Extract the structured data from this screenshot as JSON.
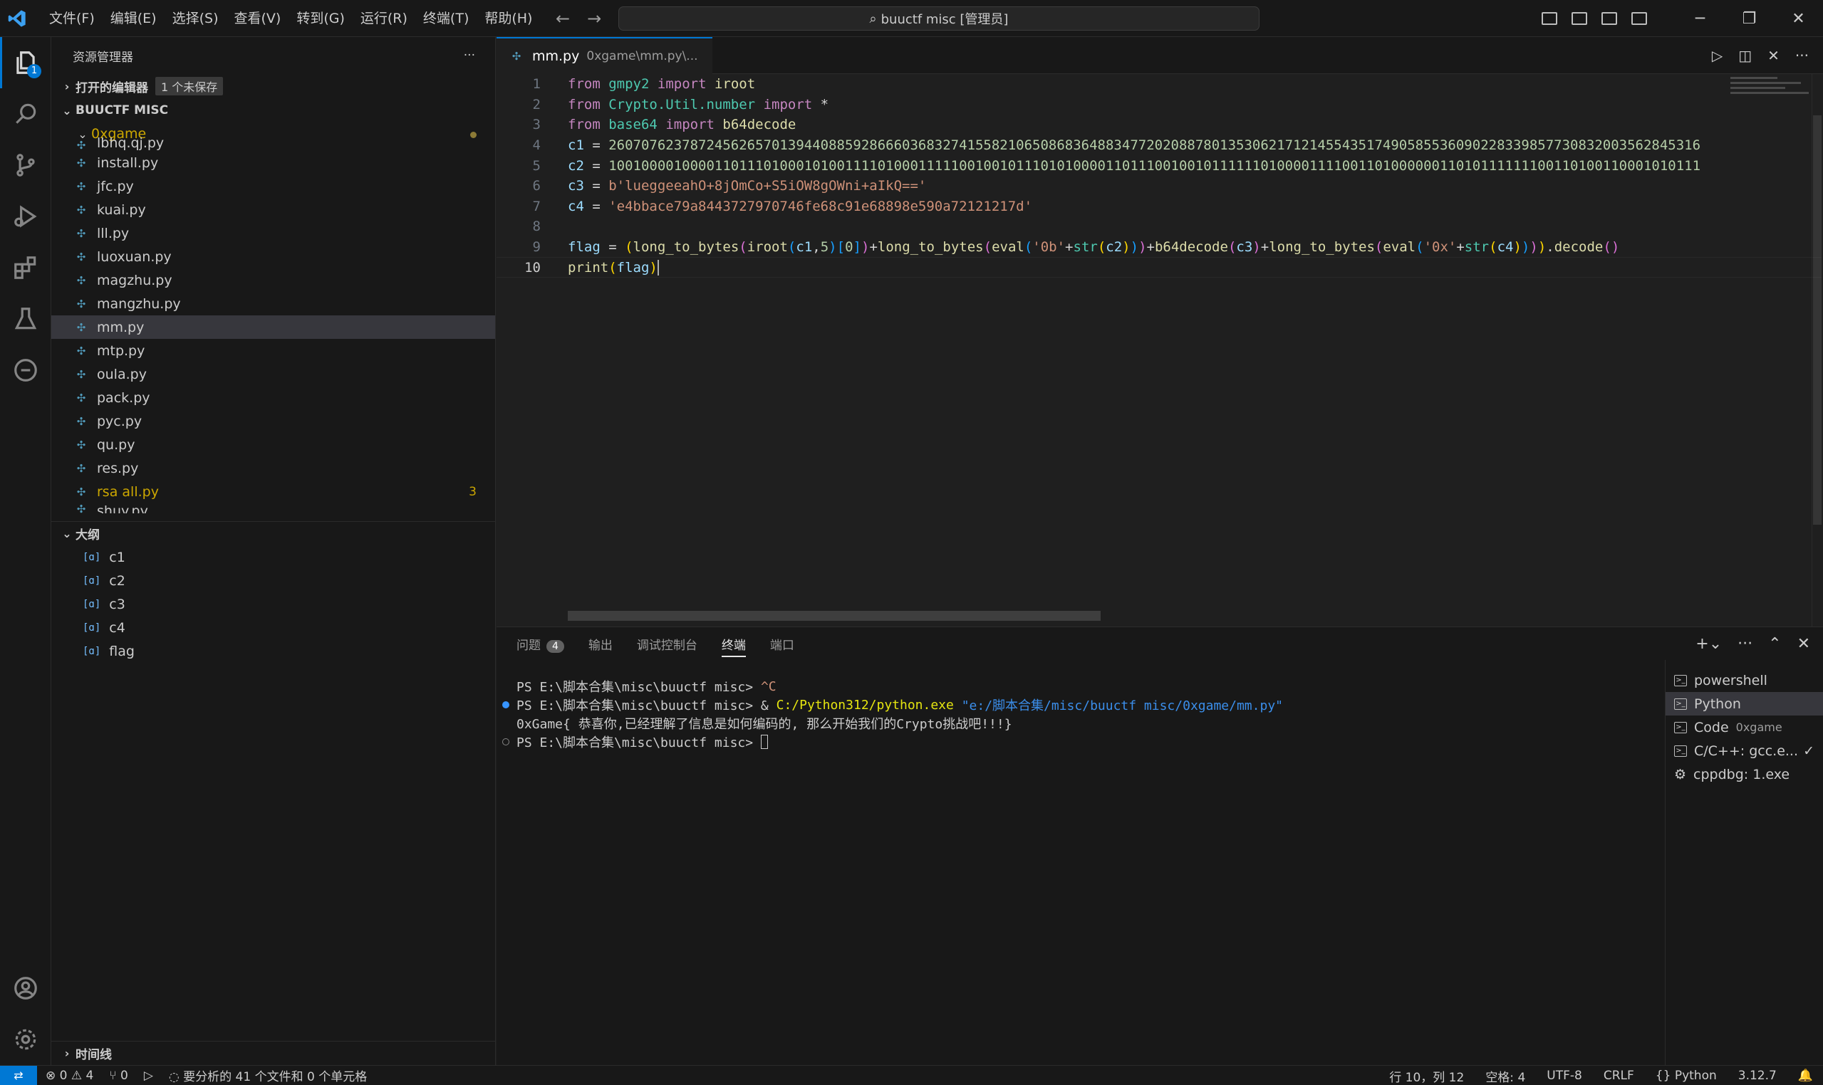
{
  "titlebar": {
    "menu": [
      "文件(F)",
      "编辑(E)",
      "选择(S)",
      "查看(V)",
      "转到(G)",
      "运行(R)",
      "终端(T)",
      "帮助(H)"
    ],
    "search": "buuctf misc [管理员]"
  },
  "activity": {
    "explorer_badge": "1"
  },
  "sidebar": {
    "title": "资源管理器",
    "open_editors": "打开的编辑器",
    "unsaved": "1 个未保存",
    "workspace": "BUUCTF MISC",
    "folder": "0xgame",
    "files": [
      {
        "name": "lbhq.qj.py"
      },
      {
        "name": "install.py"
      },
      {
        "name": "jfc.py"
      },
      {
        "name": "kuai.py"
      },
      {
        "name": "lll.py"
      },
      {
        "name": "luoxuan.py"
      },
      {
        "name": "magzhu.py"
      },
      {
        "name": "mangzhu.py"
      },
      {
        "name": "mm.py"
      },
      {
        "name": "mtp.py"
      },
      {
        "name": "oula.py"
      },
      {
        "name": "pack.py"
      },
      {
        "name": "pyc.py"
      },
      {
        "name": "qu.py"
      },
      {
        "name": "res.py"
      },
      {
        "name": "rsa all.py",
        "problems": "3"
      },
      {
        "name": "shuy.py"
      }
    ],
    "outline_title": "大纲",
    "outline": [
      "c1",
      "c2",
      "c3",
      "c4",
      "flag"
    ],
    "timeline": "时间线"
  },
  "editor": {
    "tab_name": "mm.py",
    "tab_desc": "0xgame\\mm.py\\...",
    "lines": [
      {
        "n": "1"
      },
      {
        "n": "2"
      },
      {
        "n": "3"
      },
      {
        "n": "4"
      },
      {
        "n": "5"
      },
      {
        "n": "6"
      },
      {
        "n": "7"
      },
      {
        "n": "8"
      },
      {
        "n": "9"
      },
      {
        "n": "10"
      }
    ],
    "code": {
      "l1_from": "from",
      "l1_mod": "gmpy2",
      "l1_import": "import",
      "l1_name": "iroot",
      "l2_from": "from",
      "l2_mod": "Crypto.Util.number",
      "l2_import": "import",
      "l2_star": "*",
      "l3_from": "from",
      "l3_mod": "base64",
      "l3_import": "import",
      "l3_name": "b64decode",
      "c1_name": "c1",
      "c1_val": "26070762378724562657013944088592866603683274155821065086836488347720208878013530621712145543517490585536090228339857730832003562845316",
      "c2_name": "c2",
      "c2_val": "10010000100001101110100010100111101000111110010010111010100001101110010010111111010000111100110100000011010111111100110100110001010111",
      "c3_name": "c3",
      "c3_val": "b'lueggeeahO+8jOmCo+S5iOW8gOWni+aIkQ=='",
      "c4_name": "c4",
      "c4_val": "'e4bbace79a8443727970746fe68c91e68898e590a72121217d'",
      "flag_name": "flag",
      "str_0b": "'0b'",
      "str_0x": "'0x'",
      "print": "print"
    }
  },
  "panel": {
    "tabs": [
      "问题",
      "输出",
      "调试控制台",
      "终端",
      "端口"
    ],
    "problems_count": "4",
    "terminal_lines": {
      "l1_prompt": "PS E:\\脚本合集\\misc\\buuctf misc> ",
      "l1_cmd": "^C",
      "l2_prompt": "PS E:\\脚本合集\\misc\\buuctf misc> & ",
      "l2_exe": "C:/Python312/python.exe",
      "l2_path": " \"e:/脚本合集/misc/buuctf misc/0xgame/mm.py\"",
      "l3": "0xGame{ 恭喜你,已经理解了信息是如何编码的, 那么开始我们的Crypto挑战吧!!!}",
      "l4_prompt": "PS E:\\脚本合集\\misc\\buuctf misc> "
    },
    "terminals": [
      {
        "name": "powershell",
        "sub": ""
      },
      {
        "name": "Python",
        "sub": ""
      },
      {
        "name": "Code",
        "sub": "0xgame"
      },
      {
        "name": "C/C++: gcc.e...",
        "sub": ""
      },
      {
        "name": "cppdbg: 1.exe",
        "sub": ""
      }
    ]
  },
  "status": {
    "errors": "0",
    "warnings": "4",
    "ports": "0",
    "analysis": "要分析的 41 个文件和 0 个单元格",
    "position": "行 10，列 12",
    "spaces": "空格: 4",
    "encoding": "UTF-8",
    "eol": "CRLF",
    "language": "Python",
    "version": "3.12.7"
  }
}
